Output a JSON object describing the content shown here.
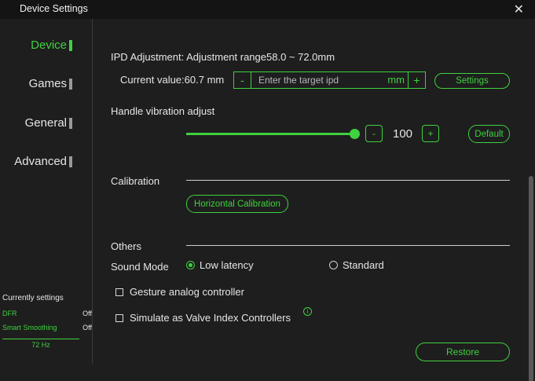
{
  "window": {
    "title": "Device Settings",
    "close_icon": "✕"
  },
  "sidebar": {
    "items": [
      {
        "label": "Device",
        "active": true
      },
      {
        "label": "Games",
        "active": false
      },
      {
        "label": "General",
        "active": false
      },
      {
        "label": "Advanced",
        "active": false
      }
    ]
  },
  "current_settings": {
    "heading": "Currently settings",
    "rows": [
      {
        "key": "DFR",
        "value": "Off"
      },
      {
        "key": "Smart Smoothing",
        "value": "Off"
      }
    ],
    "refresh": "72 Hz"
  },
  "ipd": {
    "title": "IPD Adjustment: Adjustment range58.0 ~ 72.0mm",
    "current": "Current value:60.7 mm",
    "minus": "-",
    "placeholder": "Enter the target ipd",
    "unit": "mm",
    "plus": "+",
    "settings_label": "Settings"
  },
  "vibration": {
    "title": "Handle vibration adjust",
    "level": 100,
    "level_text": "100",
    "minus": "-",
    "plus": "+",
    "default_label": "Default"
  },
  "calibration": {
    "title": "Calibration",
    "button_label": "Horizontal Calibration"
  },
  "others": {
    "title": "Others",
    "sound_mode_label": "Sound Mode",
    "sound_options": [
      {
        "label": "Low latency",
        "selected": true
      },
      {
        "label": "Standard",
        "selected": false
      }
    ],
    "gesture_label": "Gesture analog controller",
    "simulate_label": "Simulate as Valve Index Controllers",
    "info_icon": "i"
  },
  "restore_label": "Restore",
  "colors": {
    "accent": "#3fd13f",
    "background": "#1e1e1e",
    "titlebar": "#141414"
  }
}
